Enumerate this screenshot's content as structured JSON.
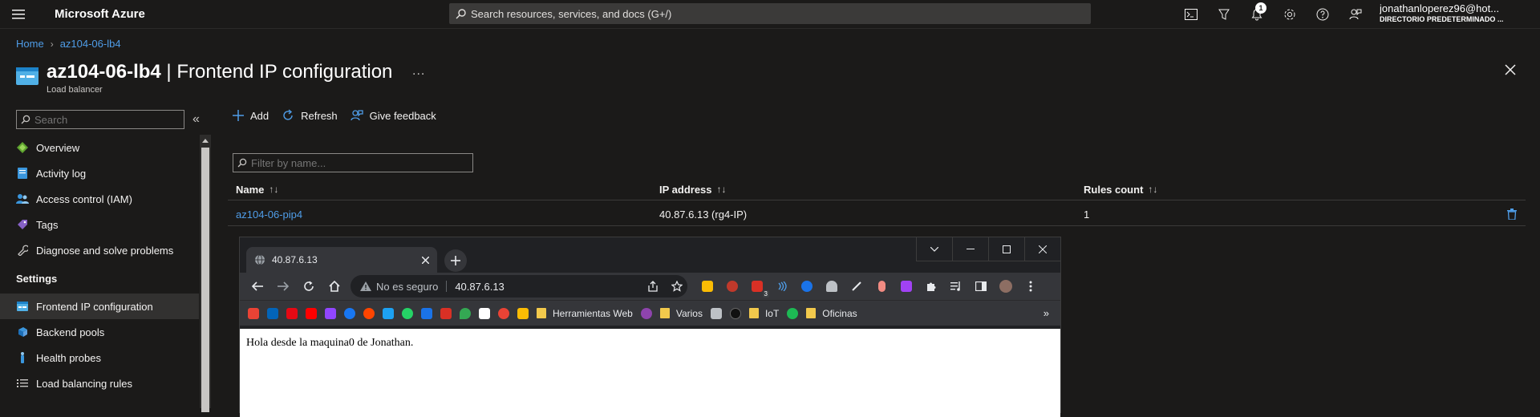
{
  "topbar": {
    "brand": "Microsoft Azure",
    "search_placeholder": "Search resources, services, and docs (G+/)",
    "notification_count": "1",
    "account_name": "jonathanloperez96@hot...",
    "account_directory": "DIRECTORIO PREDETERMINADO ..."
  },
  "breadcrumb": {
    "home": "Home",
    "resource": "az104-06-lb4"
  },
  "header": {
    "resource_name": "az104-06-lb4",
    "separator": " | ",
    "page_name": "Frontend IP configuration",
    "subtitle": "Load balancer",
    "more": "..."
  },
  "sidebar": {
    "search_placeholder": "Search",
    "collapse": "«",
    "items_top": [
      {
        "label": "Overview",
        "icon": "diamond-icon"
      },
      {
        "label": "Activity log",
        "icon": "log-icon"
      },
      {
        "label": "Access control (IAM)",
        "icon": "people-icon"
      },
      {
        "label": "Tags",
        "icon": "tag-icon"
      },
      {
        "label": "Diagnose and solve problems",
        "icon": "wrench-icon"
      }
    ],
    "section_settings": "Settings",
    "items_settings": [
      {
        "label": "Frontend IP configuration",
        "icon": "frontend-ip-icon",
        "active": true
      },
      {
        "label": "Backend pools",
        "icon": "backend-pool-icon"
      },
      {
        "label": "Health probes",
        "icon": "health-probe-icon"
      },
      {
        "label": "Load balancing rules",
        "icon": "rules-icon"
      }
    ]
  },
  "commands": {
    "add": "Add",
    "refresh": "Refresh",
    "feedback": "Give feedback"
  },
  "filter": {
    "placeholder": "Filter by name..."
  },
  "table": {
    "columns": [
      "Name",
      "IP address",
      "Rules count"
    ],
    "sort_glyph": "↑↓",
    "rows": [
      {
        "name": "az104-06-pip4",
        "ip": "40.87.6.13 (rg4-IP)",
        "rules": "1"
      }
    ]
  },
  "browser": {
    "tab_title": "40.87.6.13",
    "security_label": "No es seguro",
    "url": "40.87.6.13",
    "ext_badge": "3",
    "bookmarks": [
      {
        "type": "fav",
        "color": "#ea4335"
      },
      {
        "type": "fav",
        "color": "#0364b8"
      },
      {
        "type": "fav",
        "color": "#e50914"
      },
      {
        "type": "fav",
        "color": "#ff0000"
      },
      {
        "type": "fav",
        "color": "#9146ff"
      },
      {
        "type": "fav",
        "color": "#1877f2"
      },
      {
        "type": "fav",
        "color": "#ff4500"
      },
      {
        "type": "fav",
        "color": "#1da1f2"
      },
      {
        "type": "fav",
        "color": "#25d366"
      },
      {
        "type": "fav",
        "color": "#1a73e8"
      },
      {
        "type": "fav",
        "color": "#d93025"
      },
      {
        "type": "fav",
        "color": "#34a853"
      },
      {
        "type": "fav",
        "color": "#ffffff"
      },
      {
        "type": "fav",
        "color": "#ea4335"
      },
      {
        "type": "fav",
        "color": "#fbbc04"
      },
      {
        "type": "folder",
        "label": "Herramientas Web"
      },
      {
        "type": "fav",
        "color": "#8e44ad"
      },
      {
        "type": "folder",
        "label": "Varios"
      },
      {
        "type": "fav",
        "color": "#bdc1c6"
      },
      {
        "type": "fav",
        "color": "#202124"
      },
      {
        "type": "folder",
        "label": "IoT"
      },
      {
        "type": "fav",
        "color": "#1db954"
      },
      {
        "type": "folder",
        "label": "Oficinas"
      }
    ],
    "more": "»",
    "page_text": "Hola desde la maquina0 de Jonathan."
  },
  "colors": {
    "accent": "#4f9de8",
    "bg": "#1b1a19"
  }
}
